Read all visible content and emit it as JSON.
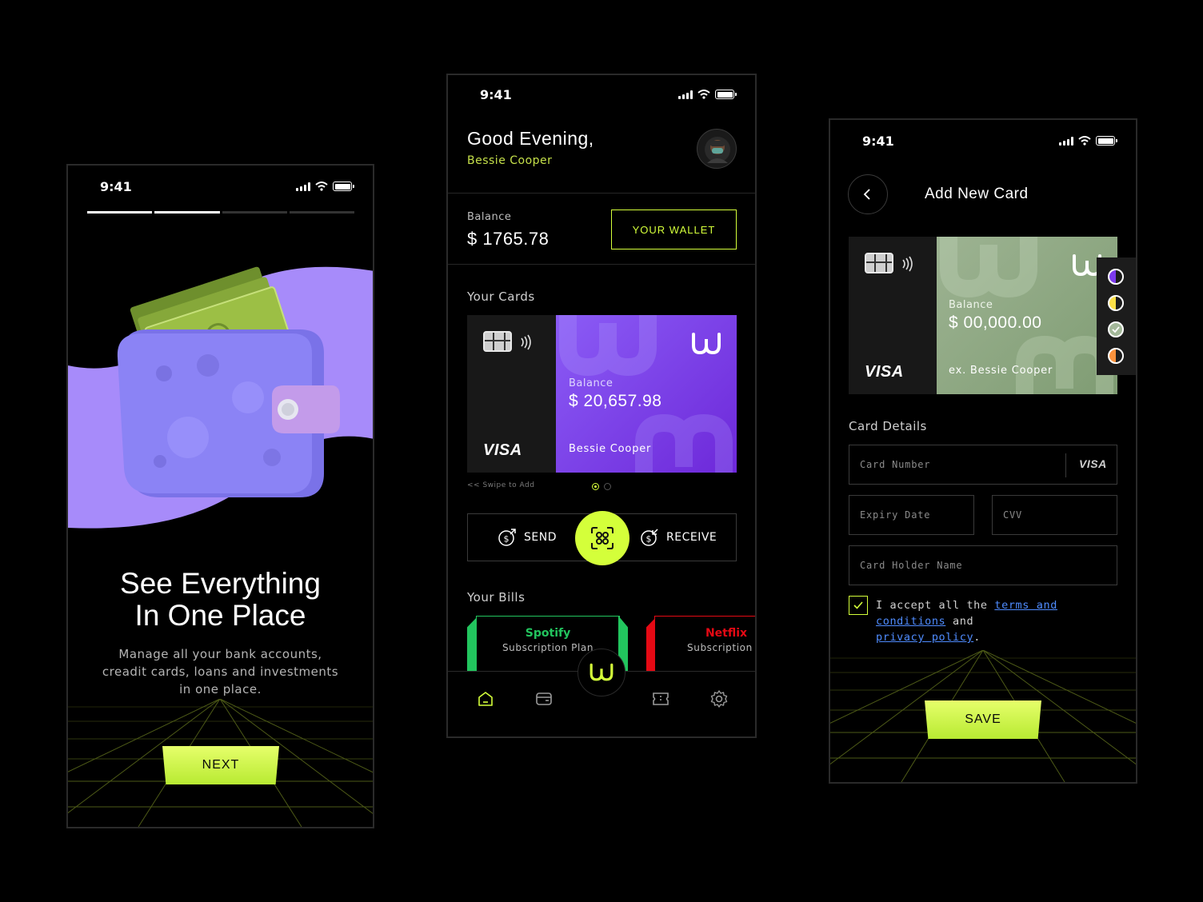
{
  "onboarding": {
    "status_time": "9:41",
    "headline_line1": "See Everything",
    "headline_line2": "In One Place",
    "body_line1": "Manage all your bank accounts,",
    "body_line2": "creadit cards, loans and investments",
    "body_line3": "in one place.",
    "next_label": "NEXT",
    "progress_steps_done": 2,
    "progress_steps_total": 4
  },
  "home": {
    "status_time": "9:41",
    "greeting": "Good Evening,",
    "user_name": "Bessie Cooper",
    "balance_label": "Balance",
    "balance_value": "$ 1765.78",
    "wallet_button": "YOUR WALLET",
    "cards_heading": "Your Cards",
    "card": {
      "brand": "VISA",
      "balance_label": "Balance",
      "balance_value": "$ 20,657.98",
      "holder": "Bessie Cooper"
    },
    "swipe_hint": "<< Swipe to Add",
    "send_label": "SEND",
    "receive_label": "RECEIVE",
    "bills_heading": "Your Bills",
    "bills": [
      {
        "name": "Spotify",
        "plan": "Subscription Plan",
        "color": "#22c55e"
      },
      {
        "name": "Netflix",
        "plan": "Subscription Pl",
        "color": "#e50914"
      }
    ]
  },
  "add_card": {
    "status_time": "9:41",
    "title": "Add New Card",
    "card": {
      "brand": "VISA",
      "balance_label": "Balance",
      "balance_value": "$ 00,000.00",
      "holder": "ex. Bessie Cooper"
    },
    "color_options": [
      "#7c3aed",
      "#fde047",
      "#a3b899",
      "#fb923c"
    ],
    "details_heading": "Card Details",
    "placeholders": {
      "card_number": "Card Number",
      "expiry": "Expiry Date",
      "cvv": "CVV",
      "holder": "Card Holder Name"
    },
    "card_number_brand": "VISA",
    "terms_prefix": "I accept all the ",
    "terms_link": "terms and conditions",
    "terms_mid": " and",
    "privacy_link": "privacy policy",
    "terms_suffix": ".",
    "save_label": "SAVE"
  },
  "colors": {
    "accent": "#d4ff3a",
    "purple_card": "#7c3aed",
    "green_card": "#8fab82",
    "lavender": "#a78bfa"
  }
}
